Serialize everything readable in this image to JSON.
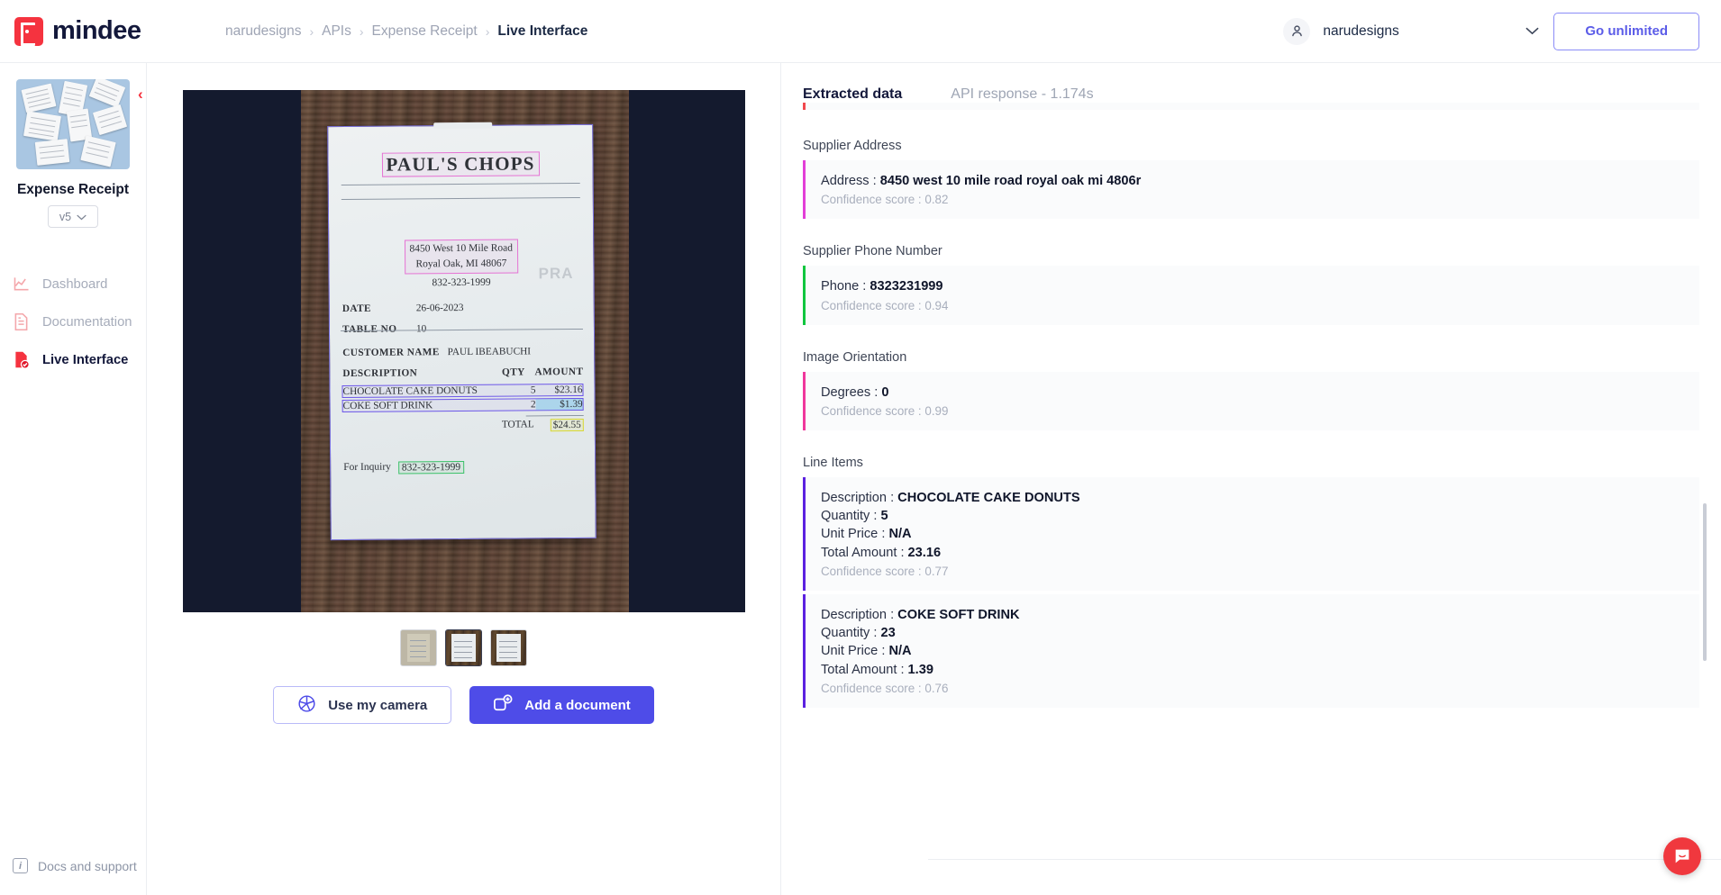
{
  "brand": {
    "name": "mindee",
    "logo_icon": "mindee-logo-icon",
    "accent_red": "#f5333f",
    "accent_indigo": "#4e4ce8"
  },
  "breadcrumb": [
    {
      "label": "narudesigns",
      "current": false
    },
    {
      "label": "APIs",
      "current": false
    },
    {
      "label": "Expense Receipt",
      "current": false
    },
    {
      "label": "Live Interface",
      "current": true
    }
  ],
  "breadcrumb_separator": "›",
  "account": {
    "name": "narudesigns",
    "avatar_icon": "user-avatar-icon",
    "chevron": "∨"
  },
  "cta": {
    "go_unlimited": "Go unlimited"
  },
  "sidebar": {
    "model_name": "Expense Receipt",
    "version": "v5",
    "version_chevron": "∨",
    "collapse_icon": "chevron-left-icon",
    "collapse_glyph": "‹",
    "nav": [
      {
        "label": "Dashboard",
        "icon": "chart-line-icon",
        "active": false
      },
      {
        "label": "Documentation",
        "icon": "document-icon",
        "active": false
      },
      {
        "label": "Live Interface",
        "icon": "document-check-icon",
        "active": true
      }
    ],
    "docs_support": {
      "label": "Docs and support",
      "icon": "info-icon",
      "glyph": "i"
    }
  },
  "viewer": {
    "receipt": {
      "title": "PAUL'S CHOPS",
      "address_line1": "8450 West 10 Mile Road",
      "address_line2": "Royal Oak, MI 48067",
      "phone": "832-323-1999",
      "watermark": "PRA",
      "date_label": "DATE",
      "date_value": "26-06-2023",
      "table_label": "TABLE NO",
      "table_value": "10",
      "customer_label": "CUSTOMER NAME",
      "customer_value": "PAUL IBEABUCHI",
      "col_description": "DESCRIPTION",
      "col_qty": "QTY",
      "col_amount": "AMOUNT",
      "items": [
        {
          "description": "CHOCOLATE CAKE DONUTS",
          "qty": "5",
          "amount": "$23.16"
        },
        {
          "description": "COKE SOFT DRINK",
          "qty": "2",
          "amount": "$1.39"
        }
      ],
      "total_label": "TOTAL",
      "total_value": "$24.55",
      "inquiry_label": "For Inquiry",
      "inquiry_value": "832-323-1999"
    },
    "thumbnails": [
      {
        "name": "thumbnail-1",
        "selected": false
      },
      {
        "name": "thumbnail-2",
        "selected": true
      },
      {
        "name": "thumbnail-3",
        "selected": false
      }
    ],
    "use_camera": {
      "label": "Use my camera",
      "icon": "camera-aperture-icon"
    },
    "add_document": {
      "label": "Add a document",
      "icon": "add-document-icon"
    }
  },
  "right_panel": {
    "tabs": [
      {
        "label": "Extracted data",
        "active": true
      },
      {
        "label": "API response - 1.174s",
        "active": false
      }
    ],
    "fields": [
      {
        "label": "",
        "border_color": "#f1484e",
        "lines": [
          {
            "key": "",
            "value": "-"
          }
        ],
        "confidence": ""
      },
      {
        "label": "Supplier Address",
        "border_color": "#e23fd8",
        "lines": [
          {
            "key": "Address",
            "value": "8450 west 10 mile road royal oak mi 4806r"
          }
        ],
        "confidence": "Confidence score : 0.82"
      },
      {
        "label": "Supplier Phone Number",
        "border_color": "#11c63f",
        "lines": [
          {
            "key": "Phone",
            "value": "8323231999"
          }
        ],
        "confidence": "Confidence score : 0.94"
      },
      {
        "label": "Image Orientation",
        "border_color": "#f0379c",
        "lines": [
          {
            "key": "Degrees",
            "value": "0"
          }
        ],
        "confidence": "Confidence score : 0.99"
      },
      {
        "label": "Line Items",
        "border_color": "#5b21e0",
        "lines": [
          {
            "key": "Description",
            "value": "CHOCOLATE CAKE DONUTS"
          },
          {
            "key": "Quantity",
            "value": "5"
          },
          {
            "key": "Unit Price",
            "value": "N/A"
          },
          {
            "key": "Total Amount",
            "value": "23.16"
          }
        ],
        "confidence": "Confidence score : 0.77"
      },
      {
        "label": "",
        "border_color": "#5b21e0",
        "lines": [
          {
            "key": "Description",
            "value": "COKE SOFT DRINK"
          },
          {
            "key": "Quantity",
            "value": "23"
          },
          {
            "key": "Unit Price",
            "value": "N/A"
          },
          {
            "key": "Total Amount",
            "value": "1.39"
          }
        ],
        "confidence": "Confidence score : 0.76"
      }
    ]
  },
  "support_widget": {
    "icon": "intercom-chat-icon"
  }
}
